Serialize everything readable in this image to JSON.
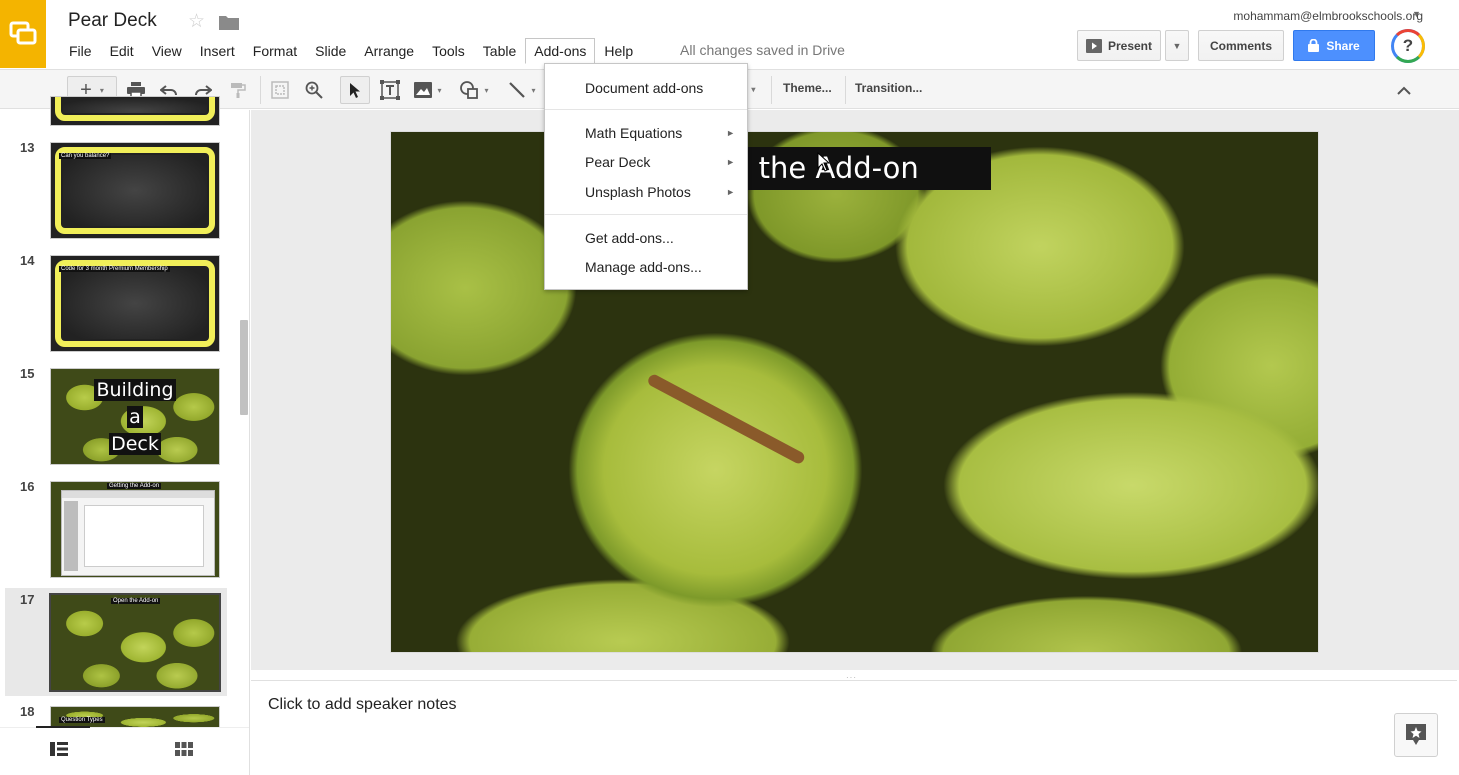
{
  "app": {
    "doc_title": "Pear Deck",
    "account_email": "mohammam@elmbrookschools.org",
    "saved_status": "All changes saved in Drive"
  },
  "menubar": {
    "items": [
      "File",
      "Edit",
      "View",
      "Insert",
      "Format",
      "Slide",
      "Arrange",
      "Tools",
      "Table",
      "Add-ons",
      "Help"
    ],
    "active": "Add-ons"
  },
  "header_buttons": {
    "present": "Present",
    "comments": "Comments",
    "share": "Share",
    "help": "?"
  },
  "toolbar": {
    "theme": "Theme...",
    "transition": "Transition...",
    "partial_hidden": "t"
  },
  "addons_menu": {
    "document_addons": "Document add-ons",
    "items": [
      {
        "label": "Math Equations",
        "has_submenu": true
      },
      {
        "label": "Pear Deck",
        "has_submenu": true
      },
      {
        "label": "Unsplash Photos",
        "has_submenu": true
      }
    ],
    "get_addons": "Get add-ons...",
    "manage_addons": "Manage add-ons..."
  },
  "slides": [
    {
      "num": "13",
      "label": "Can you balance?"
    },
    {
      "num": "14",
      "label": "Code for 3 month Premium Membership"
    },
    {
      "num": "15",
      "label_lines": [
        "Building",
        "a",
        "Deck"
      ]
    },
    {
      "num": "16",
      "label": "Getting the Add-on"
    },
    {
      "num": "17",
      "label": "Open the Add-on",
      "selected": true
    },
    {
      "num": "18",
      "label": "Question Types"
    }
  ],
  "main_slide": {
    "title": "Open the Add-on"
  },
  "notes": {
    "placeholder": "Click to add speaker notes"
  },
  "colors": {
    "logo": "#f4b400",
    "share": "#4d90fe",
    "thumb_frame": "#f1ef59"
  }
}
